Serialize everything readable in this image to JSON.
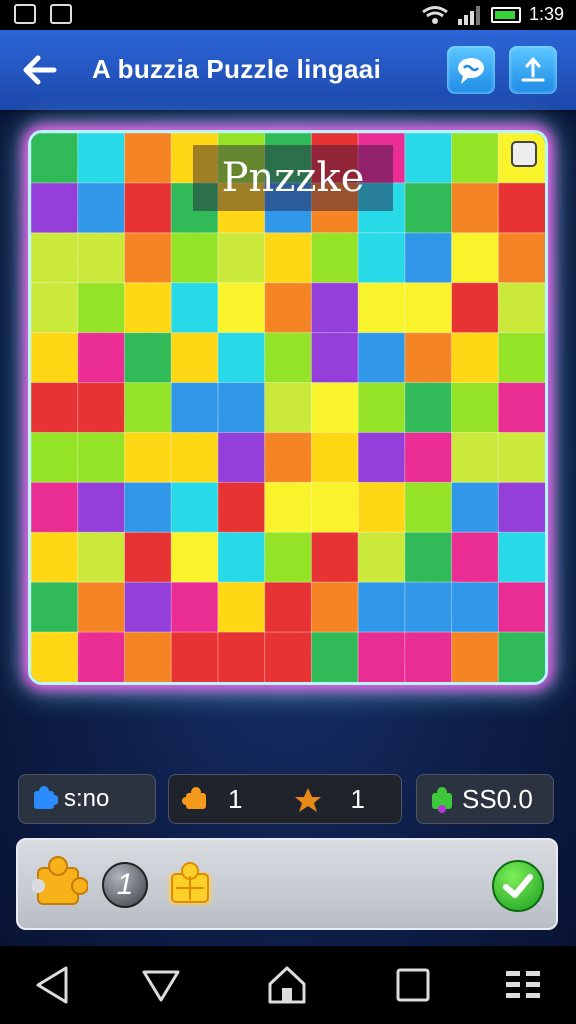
{
  "status_bar": {
    "time": "1:39"
  },
  "header": {
    "back_icon": "arrow-left-icon",
    "title": "A buzzia Puzzle lingaai",
    "buttons": [
      {
        "icon": "chat-bubble-icon"
      },
      {
        "icon": "share-icon"
      }
    ]
  },
  "board": {
    "banner": "Pnzzke",
    "corner_icon": "card-icon",
    "colors": [
      "#e52222",
      "#f57b12",
      "#ffd400",
      "#f8f21a",
      "#8be114",
      "#1fb64a",
      "#16d6e6",
      "#1f8fe8",
      "#8b2fd6",
      "#e81c8a",
      "#c7e82a"
    ]
  },
  "stats": {
    "moves": {
      "icon": "blue-puzzle-piece-icon",
      "value": "s:no"
    },
    "counter_a": {
      "icon": "orange-puzzle-piece-icon",
      "value": "1"
    },
    "counter_b": {
      "icon": "orange-puzzle-piece-icon",
      "value": "1"
    },
    "score": {
      "icon": "green-puzzle-piece-icon",
      "value": "SS0.0"
    }
  },
  "tray": {
    "slots": [
      {
        "icon": "yellow-puzzle-piece-icon"
      },
      {
        "icon": "hint-coin-icon",
        "label": "1"
      },
      {
        "icon": "glowing-puzzle-piece-icon"
      }
    ],
    "confirm_icon": "checkmark-icon"
  },
  "nav_bar": {
    "buttons": [
      "back-triangle-icon",
      "home-triangle-icon",
      "home-icon",
      "recents-icon",
      "menu-icon"
    ]
  }
}
